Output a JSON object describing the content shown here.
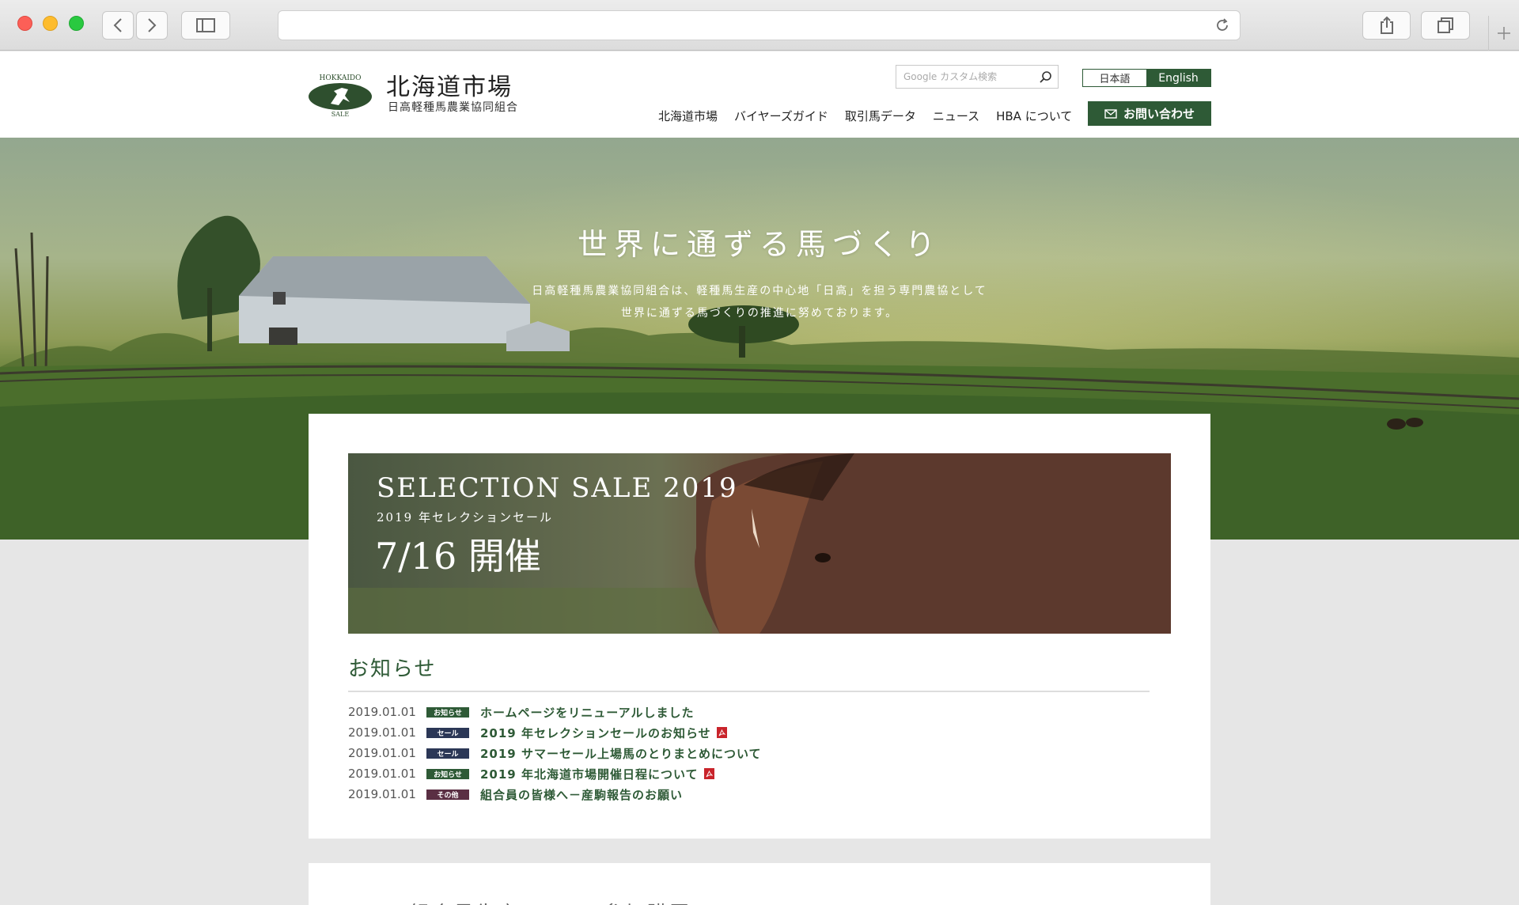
{
  "browser": {
    "url": ""
  },
  "header": {
    "logo_emblem_top": "HOKKAIDO",
    "logo_emblem_bottom": "SALE",
    "site_title": "北海道市場",
    "site_subtitle": "日高軽種馬農業協同組合",
    "search_placeholder": "Google カスタム検索",
    "lang_ja": "日本語",
    "lang_en": "English",
    "nav": [
      {
        "label": "北海道市場"
      },
      {
        "label": "バイヤーズガイド"
      },
      {
        "label": "取引馬データ"
      },
      {
        "label": "ニュース"
      },
      {
        "label": "HBA について"
      }
    ],
    "contact_label": "お問い合わせ"
  },
  "hero": {
    "title": "世界に通ずる馬づくり",
    "desc_line1": "日高軽種馬農業協同組合は、軽種馬生産の中心地「日高」を担う専門農協として",
    "desc_line2": "世界に通ずる馬づくりの推進に努めております。"
  },
  "banner": {
    "title_en": "SELECTION SALE 2019",
    "title_ja": "2019 年セレクションセール",
    "date": "7/16 開催"
  },
  "news": {
    "heading": "お知らせ",
    "items": [
      {
        "date": "2019.01.01",
        "tag": "お知らせ",
        "tag_type": "notice",
        "title": "ホームページをリニューアルしました",
        "pdf": false
      },
      {
        "date": "2019.01.01",
        "tag": "セール",
        "tag_type": "sale",
        "title": "2019 年セレクションセールのお知らせ",
        "pdf": true
      },
      {
        "date": "2019.01.01",
        "tag": "セール",
        "tag_type": "sale",
        "title": "2019 サマーセール上場馬のとりまとめについて",
        "pdf": false
      },
      {
        "date": "2019.01.01",
        "tag": "お知らせ",
        "tag_type": "notice",
        "title": "2019 年北海道市場開催日程について",
        "pdf": true
      },
      {
        "date": "2019.01.01",
        "tag": "その他",
        "tag_type": "other",
        "title": "組合員の皆様へ－産駒報告のお願い",
        "pdf": false
      }
    ]
  },
  "section2": {
    "heading_partial": "HBA 組合員生産・HBA 参加購買"
  },
  "colors": {
    "brand_green": "#2e5a36",
    "sale_navy": "#2b3756",
    "other_plum": "#5a2f43",
    "pdf_red": "#c9242b"
  }
}
